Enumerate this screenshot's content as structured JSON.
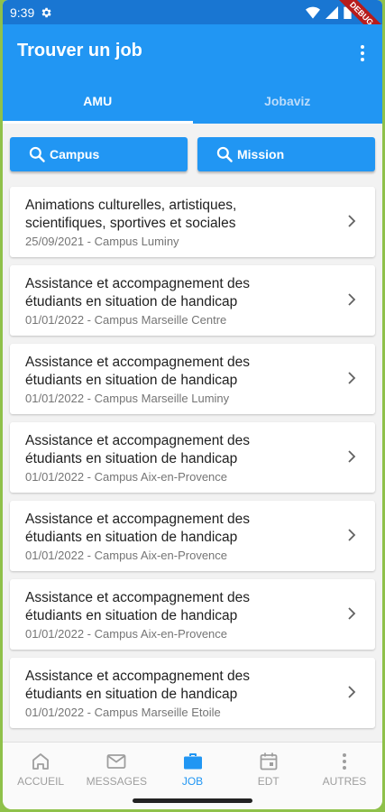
{
  "status": {
    "time": "9:39",
    "debug_label": "DEBUG"
  },
  "appbar": {
    "title": "Trouver un job"
  },
  "tabs": [
    {
      "label": "AMU",
      "active": true
    },
    {
      "label": "Jobaviz",
      "active": false
    }
  ],
  "search": {
    "campus_label": "Campus",
    "mission_label": "Mission"
  },
  "jobs": [
    {
      "title_line1": "Animations culturelles, artistiques,",
      "title_line2": "scientifiques, sportives et sociales",
      "subtitle": "25/09/2021 - Campus Luminy"
    },
    {
      "title_line1": "Assistance et accompagnement des",
      "title_line2": "étudiants en situation de handicap",
      "subtitle": "01/01/2022 - Campus Marseille Centre"
    },
    {
      "title_line1": "Assistance et accompagnement des",
      "title_line2": "étudiants en situation de handicap",
      "subtitle": "01/01/2022 - Campus Marseille Luminy"
    },
    {
      "title_line1": "Assistance et accompagnement des",
      "title_line2": "étudiants en situation de handicap",
      "subtitle": "01/01/2022 - Campus Aix-en-Provence"
    },
    {
      "title_line1": "Assistance et accompagnement des",
      "title_line2": "étudiants en situation de handicap",
      "subtitle": "01/01/2022 - Campus Aix-en-Provence"
    },
    {
      "title_line1": "Assistance et accompagnement des",
      "title_line2": "étudiants en situation de handicap",
      "subtitle": "01/01/2022 - Campus Aix-en-Provence"
    },
    {
      "title_line1": "Assistance et accompagnement des",
      "title_line2": "étudiants en situation de handicap",
      "subtitle": "01/01/2022 - Campus Marseille Etoile"
    }
  ],
  "bottom_nav": [
    {
      "label": "ACCUEIL",
      "icon": "home-icon",
      "active": false
    },
    {
      "label": "MESSAGES",
      "icon": "mail-icon",
      "active": false
    },
    {
      "label": "JOB",
      "icon": "briefcase-icon",
      "active": true
    },
    {
      "label": "EDT",
      "icon": "calendar-icon",
      "active": false
    },
    {
      "label": "AUTRES",
      "icon": "more-vert-icon",
      "active": false
    }
  ],
  "colors": {
    "primary": "#2196f3",
    "status_bar": "#1976d2",
    "background": "#f2f2f2"
  }
}
